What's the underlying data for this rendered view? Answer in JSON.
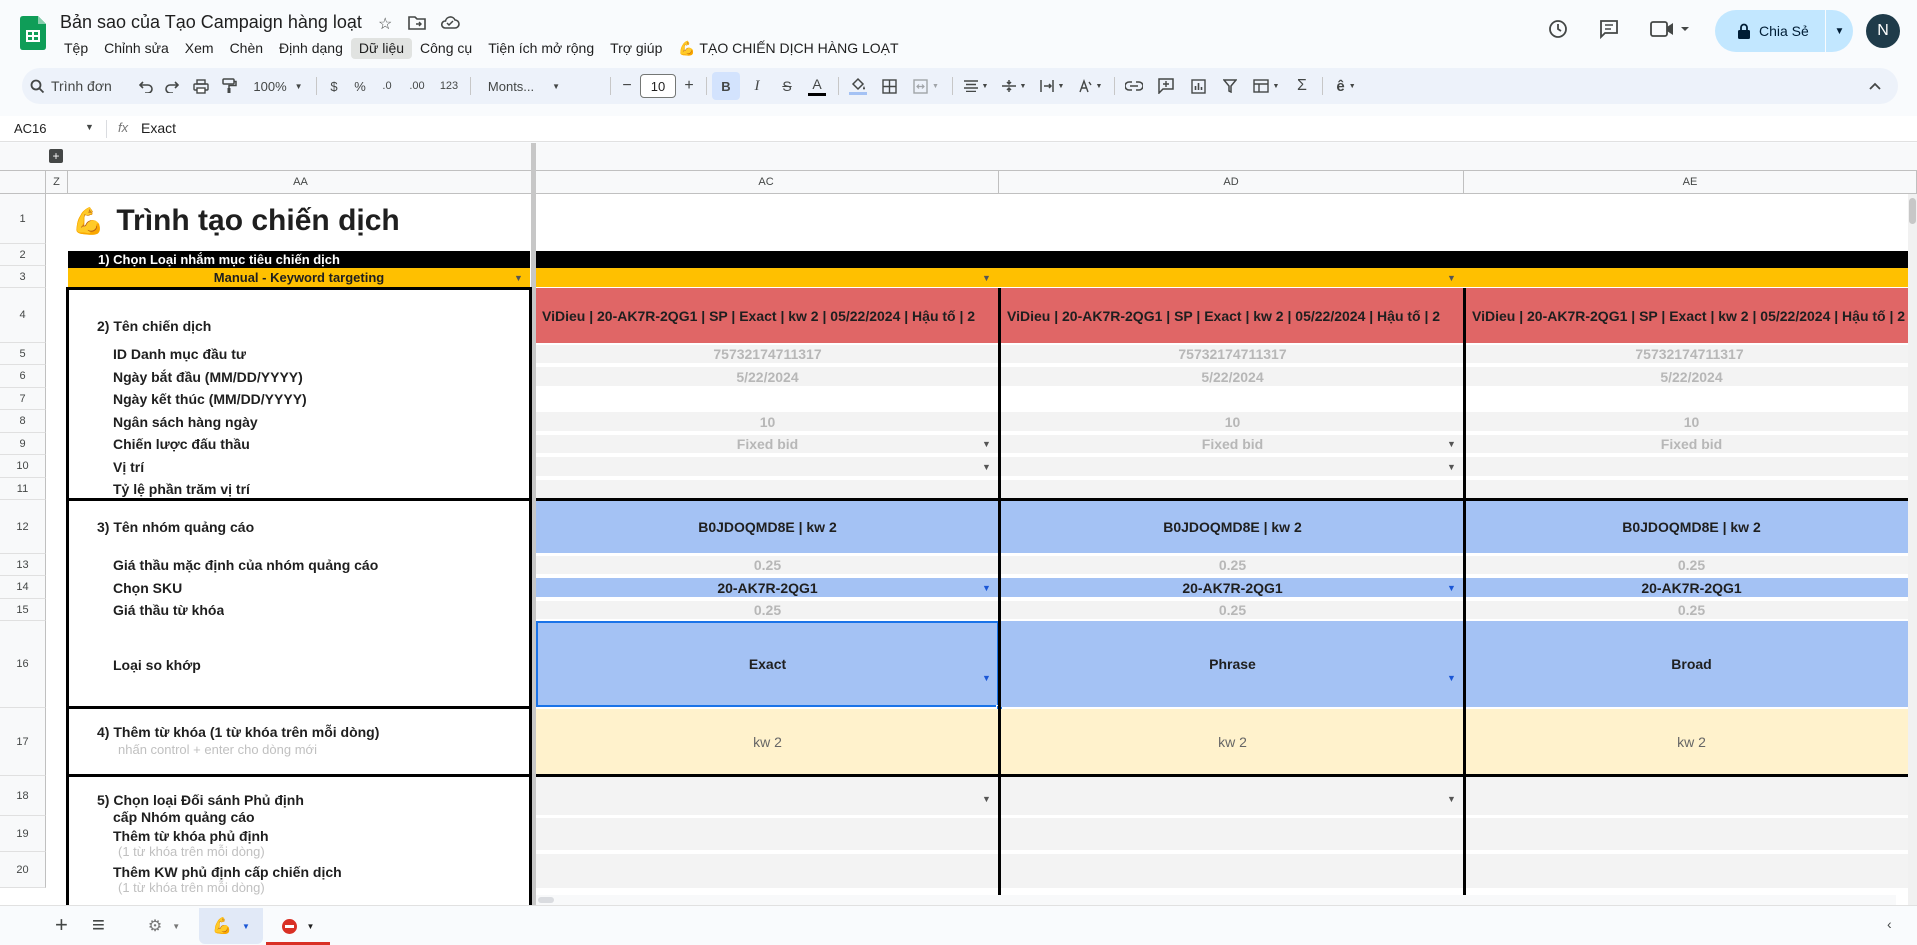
{
  "app": {
    "title": "Bản sao của Tạo Campaign hàng loạt",
    "menus": [
      "Tệp",
      "Chỉnh sửa",
      "Xem",
      "Chèn",
      "Định dạng",
      "Dữ liệu",
      "Công cụ",
      "Tiện ích mở rộng",
      "Trợ giúp",
      "💪 TẠO CHIẾN DỊCH HÀNG LOẠT"
    ],
    "active_menu_index": 5,
    "share_label": "Chia Sẻ",
    "avatar_letter": "N"
  },
  "toolbar": {
    "search_label": "Trình đơn",
    "zoom": "100%",
    "currency": "$",
    "percent": "%",
    "dec_decrease": ".0",
    "dec_increase": ".00",
    "number_format": "123",
    "font_family": "Monts...",
    "font_size": "10",
    "minus": "−",
    "plus": "+"
  },
  "formula_bar": {
    "cell_ref": "AC16",
    "fx": "fx",
    "value": "Exact"
  },
  "columns": [
    "Z",
    "AA",
    "AC",
    "AD",
    "AE"
  ],
  "rows": [
    "1",
    "2",
    "3",
    "4",
    "5",
    "6",
    "7",
    "8",
    "9",
    "10",
    "11",
    "12",
    "13",
    "14",
    "15",
    "16",
    "17",
    "18",
    "19",
    "20"
  ],
  "sheet": {
    "header_title": "Trình tạo chiến dịch",
    "header_emoji": "💪",
    "row2_label": "1) Chọn Loại nhắm mục tiêu chiến dịch",
    "row3_value": "Manual - Keyword targeting",
    "row4_label": "2) Tên chiến dịch",
    "row5_label": "ID Danh mục đầu tư",
    "row6_label": "Ngày bắt đầu (MM/DD/YYYY)",
    "row7_label": "Ngày kết thúc (MM/DD/YYYY)",
    "row8_label": "Ngân sách hàng ngày",
    "row9_label": "Chiến lược đấu thầu",
    "row10_label": "Vị trí",
    "row11_label": "Tỷ lệ phần trăm vị trí",
    "row12_label": "3) Tên nhóm quảng cáo",
    "row13_label": "Giá thầu mặc định của nhóm quảng cáo",
    "row14_label": "Chọn SKU",
    "row15_label": "Giá thầu từ khóa",
    "row16_label": "Loại so khớp",
    "row17_label": "4) Thêm từ khóa (1 từ khóa trên mỗi dòng)",
    "row17_hint": "nhấn control + enter cho dòng mới",
    "row18_label_1": "5) Chọn loại Đối sánh Phủ định",
    "row18_label_2": "cấp Nhóm quảng cáo",
    "row19_label": "Thêm từ khóa phủ định",
    "row19_hint": "(1 từ khóa trên mỗi dòng)",
    "row20_label": "Thêm KW phủ định cấp chiến dịch",
    "row20_hint": "(1 từ khóa trên mỗi dòng)",
    "campaigns": [
      {
        "name": "ViDieu | 20-AK7R-2QG1 | SP | Exact | kw 2  | 05/22/2024 | Hậu tố | 2",
        "portfolio": "75732174711317",
        "start": "5/22/2024",
        "budget": "10",
        "strategy": "Fixed bid",
        "adgroup": "B0JDOQMD8E | kw 2",
        "default_bid": "0.25",
        "sku": "20-AK7R-2QG1",
        "kw_bid": "0.25",
        "match": "Exact",
        "keywords": "kw 2"
      },
      {
        "name": "ViDieu | 20-AK7R-2QG1 | SP | Exact | kw 2  | 05/22/2024 | Hậu tố | 2",
        "portfolio": "75732174711317",
        "start": "5/22/2024",
        "budget": "10",
        "strategy": "Fixed bid",
        "adgroup": "B0JDOQMD8E | kw 2",
        "default_bid": "0.25",
        "sku": "20-AK7R-2QG1",
        "kw_bid": "0.25",
        "match": "Phrase",
        "keywords": "kw 2"
      },
      {
        "name": "ViDieu | 20-AK7R-2QG1 | SP | Exact | kw 2  | 05/22/2024 | Hậu tố | 2",
        "portfolio": "75732174711317",
        "start": "5/22/2024",
        "budget": "10",
        "strategy": "Fixed bid",
        "adgroup": "B0JDOQMD8E | kw 2",
        "default_bid": "0.25",
        "sku": "20-AK7R-2QG1",
        "kw_bid": "0.25",
        "match": "Broad",
        "keywords": "kw 2"
      }
    ]
  },
  "tabs": {
    "add": "+",
    "list": "≡"
  },
  "colors": {
    "black_band": "#000000",
    "yellow": "#ffc000",
    "red": "#e06666",
    "blue": "#a4c2f4",
    "cream": "#fff2cc",
    "share_bg": "#c2e7ff"
  }
}
